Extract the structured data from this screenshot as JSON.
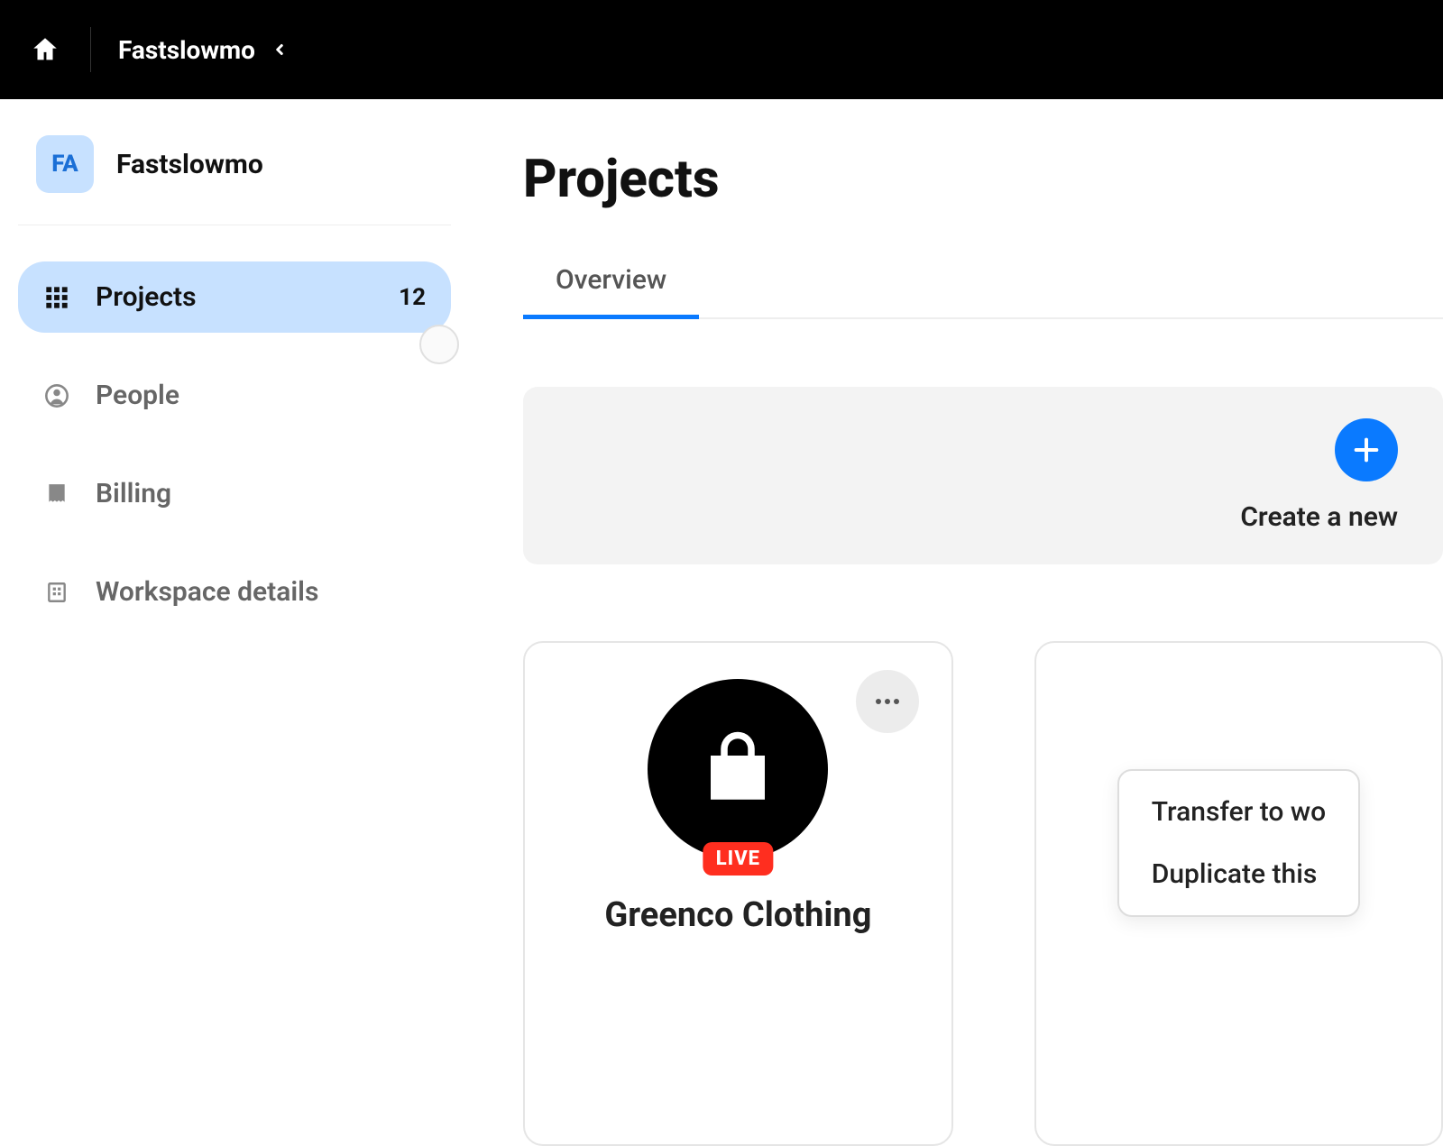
{
  "header": {
    "breadcrumb": "Fastslowmo"
  },
  "workspace": {
    "initials": "FA",
    "name": "Fastslowmo"
  },
  "sidebar": {
    "items": [
      {
        "label": "Projects",
        "count": "12"
      },
      {
        "label": "People"
      },
      {
        "label": "Billing"
      },
      {
        "label": "Workspace details"
      }
    ]
  },
  "main": {
    "title": "Projects",
    "tabs": [
      "Overview"
    ],
    "create_label": "Create a new",
    "cards": [
      {
        "status": "LIVE",
        "title": "Greenco Clothing"
      }
    ],
    "menu": {
      "items": [
        "Transfer to wo",
        "Duplicate this"
      ]
    }
  }
}
